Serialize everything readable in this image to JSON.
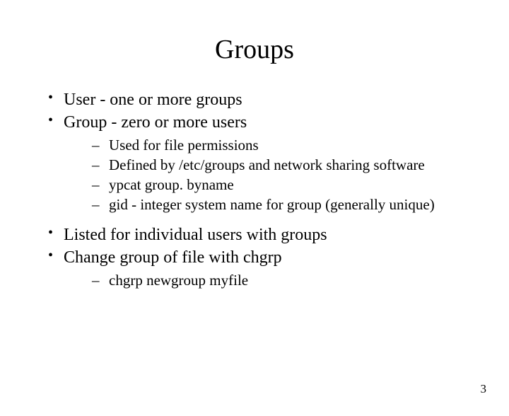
{
  "title": "Groups",
  "bullets": [
    {
      "text": "User - one or more groups"
    },
    {
      "text": "Group - zero or more users",
      "sub": [
        "Used for file permissions",
        "Defined by /etc/groups and network sharing software",
        "ypcat group. byname",
        "gid - integer system name for group (generally unique)"
      ]
    },
    {
      "text": "Listed for individual users with groups"
    },
    {
      "text": "Change group of file with chgrp",
      "sub": [
        "chgrp newgroup myfile"
      ]
    }
  ],
  "page_number": "3"
}
